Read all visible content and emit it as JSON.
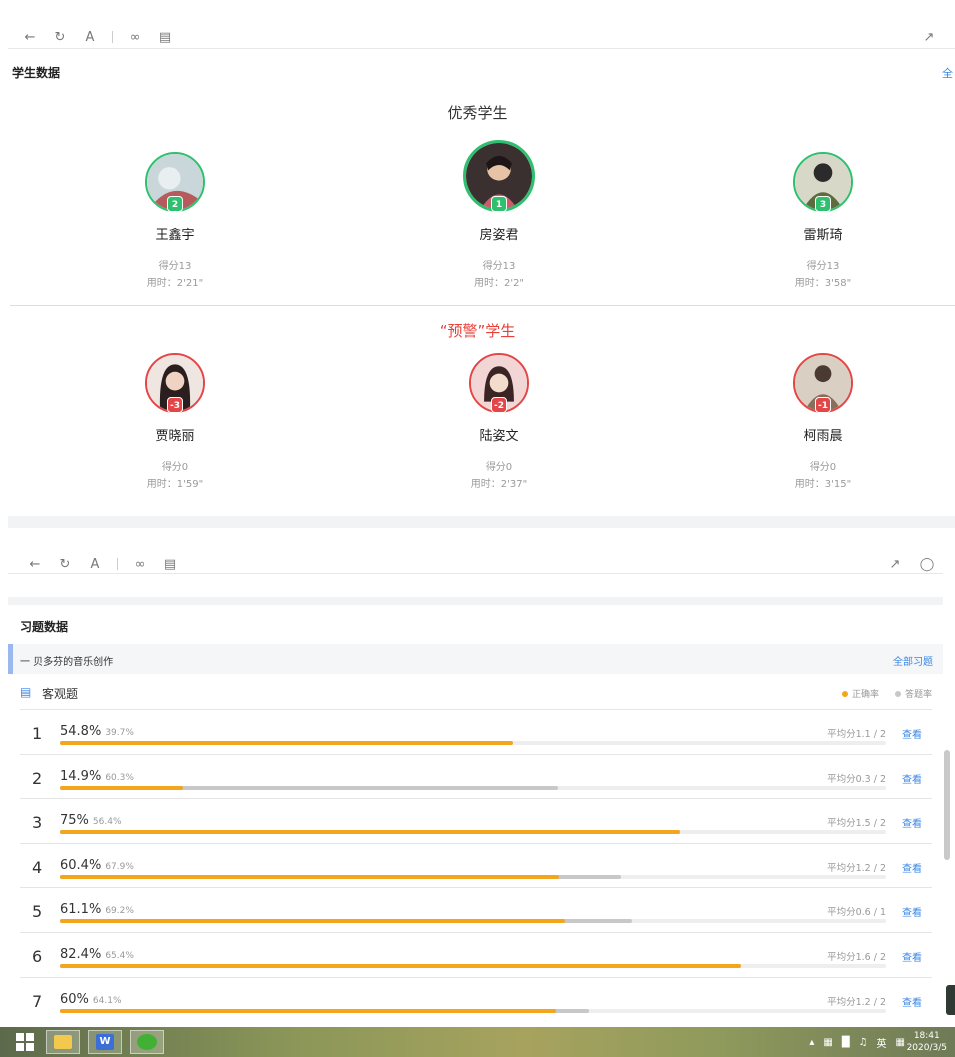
{
  "student_data": {
    "title": "学生数据",
    "all_link": "全",
    "excellent_title": "优秀学生",
    "warning_title": "“预警”学生",
    "score_prefix": "得分",
    "time_prefix": "用时：",
    "excellent": [
      {
        "rank": "2",
        "name": "王鑫宇",
        "score": "得分13",
        "time": "用时：2'21\""
      },
      {
        "rank": "1",
        "name": "房姿君",
        "score": "得分13",
        "time": "用时：2'2\""
      },
      {
        "rank": "3",
        "name": "雷斯琦",
        "score": "得分13",
        "time": "用时：3'58\""
      }
    ],
    "warning": [
      {
        "rank": "-3",
        "name": "贾晓丽",
        "score": "得分0",
        "time": "用时：1'59\""
      },
      {
        "rank": "-2",
        "name": "陆姿文",
        "score": "得分0",
        "time": "用时：2'37\""
      },
      {
        "rank": "-1",
        "name": "柯雨晨",
        "score": "得分0",
        "time": "用时：3'15\""
      }
    ]
  },
  "exercise_data": {
    "title": "习题数据",
    "lesson_name": "一 贝多芬的音乐创作",
    "all_exercises_link": "全部习题",
    "objective_label": "客观题",
    "legend": {
      "correct": "正确率",
      "answered": "答题率"
    },
    "colors": {
      "correct": "#f3a51b",
      "answered": "#c8c8c8",
      "link": "#3a87e6"
    },
    "view_label": "查看",
    "questions": [
      {
        "num": "1",
        "correct": "54.8%",
        "correct_value": 54.8,
        "answered": "39.7%",
        "answered_value": 39.7,
        "avg": "平均分1.1 / 2"
      },
      {
        "num": "2",
        "correct": "14.9%",
        "correct_value": 14.9,
        "answered": "60.3%",
        "answered_value": 60.3,
        "avg": "平均分0.3 / 2"
      },
      {
        "num": "3",
        "correct": "75%",
        "correct_value": 75,
        "answered": "56.4%",
        "answered_value": 56.4,
        "avg": "平均分1.5 / 2"
      },
      {
        "num": "4",
        "correct": "60.4%",
        "correct_value": 60.4,
        "answered": "67.9%",
        "answered_value": 67.9,
        "avg": "平均分1.2 / 2"
      },
      {
        "num": "5",
        "correct": "61.1%",
        "correct_value": 61.1,
        "answered": "69.2%",
        "answered_value": 69.2,
        "avg": "平均分0.6 / 1"
      },
      {
        "num": "6",
        "correct": "82.4%",
        "correct_value": 82.4,
        "answered": "65.4%",
        "answered_value": 65.4,
        "avg": "平均分1.6 / 2"
      },
      {
        "num": "7",
        "correct": "60%",
        "correct_value": 60,
        "answered": "64.1%",
        "answered_value": 64.1,
        "avg": "平均分1.2 / 2"
      }
    ]
  },
  "taskbar": {
    "ime": "英",
    "time": "18:41",
    "date": "2020/3/5"
  }
}
